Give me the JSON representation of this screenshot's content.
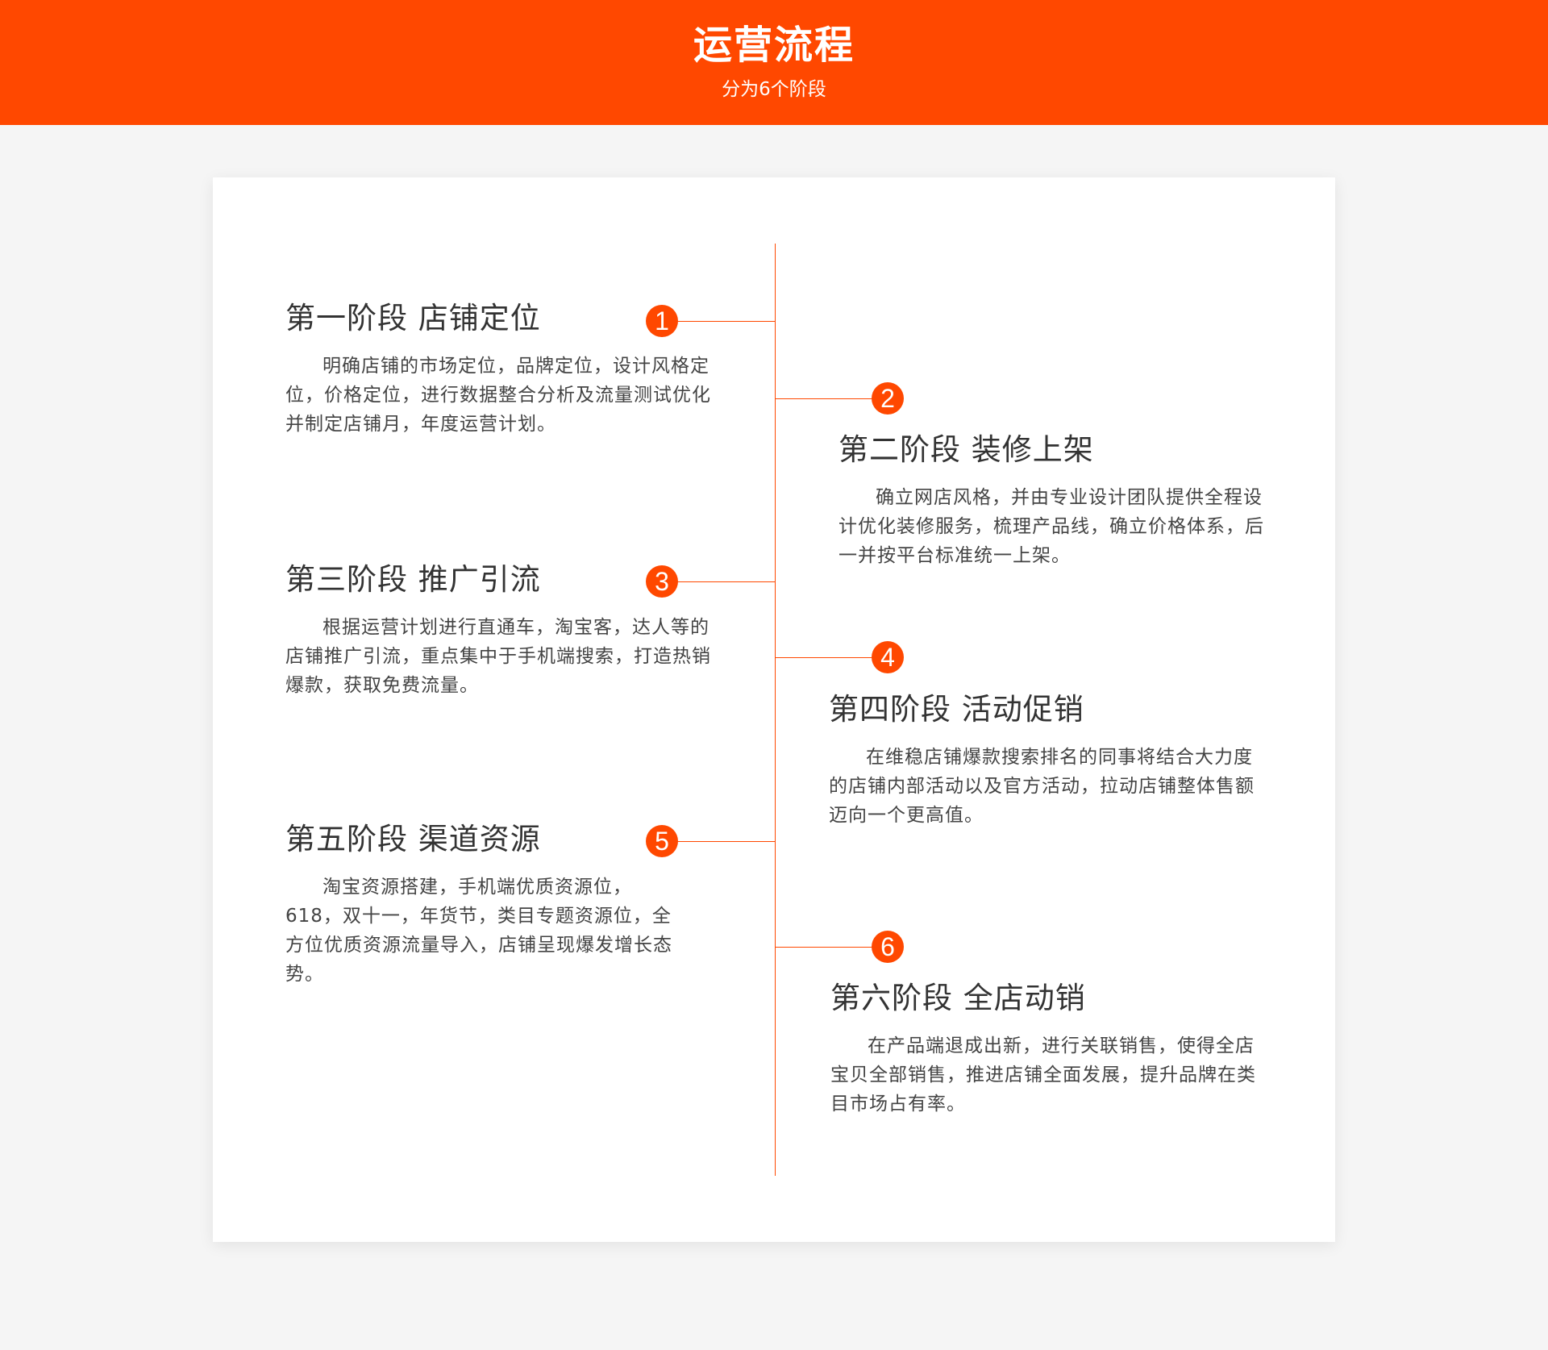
{
  "header": {
    "title": "运营流程",
    "subtitle": "分为6个阶段"
  },
  "stages": [
    {
      "number": "1",
      "title": "第一阶段 店铺定位",
      "description": "明确店铺的市场定位，品牌定位，设计风格定位，价格定位，进行数据整合分析及流量测试优化并制定店铺月，年度运营计划。"
    },
    {
      "number": "2",
      "title": "第二阶段 装修上架",
      "description": "确立网店风格，并由专业设计团队提供全程设计优化装修服务，梳理产品线，确立价格体系，后一并按平台标准统一上架。"
    },
    {
      "number": "3",
      "title": "第三阶段 推广引流",
      "description": "根据运营计划进行直通车，淘宝客，达人等的店铺推广引流，重点集中于手机端搜索，打造热销爆款，获取免费流量。"
    },
    {
      "number": "4",
      "title": "第四阶段 活动促销",
      "description": "在维稳店铺爆款搜索排名的同事将结合大力度的店铺内部活动以及官方活动，拉动店铺整体售额迈向一个更高值。"
    },
    {
      "number": "5",
      "title": "第五阶段 渠道资源",
      "description": "淘宝资源搭建，手机端优质资源位，618，双十一，年货节，类目专题资源位，全方位优质资源流量导入，店铺呈现爆发增长态势。"
    },
    {
      "number": "6",
      "title": "第六阶段 全店动销",
      "description": "在产品端退成出新，进行关联销售，使得全店宝贝全部销售，推进店铺全面发展，提升品牌在类目市场占有率。"
    }
  ],
  "colors": {
    "accent": "#ff4800",
    "background": "#f5f5f5",
    "card": "#ffffff",
    "text": "#333333"
  }
}
